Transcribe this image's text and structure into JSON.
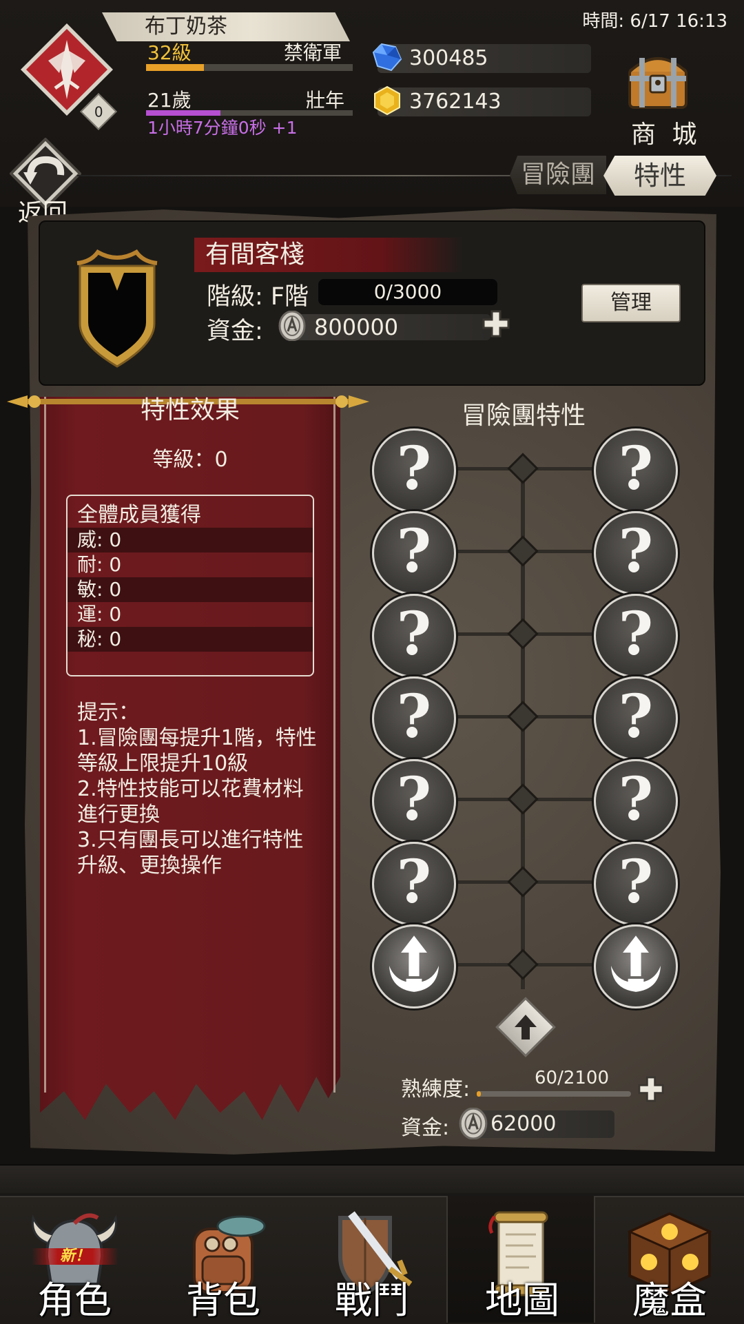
{
  "header": {
    "clock": "時間: 6/17 16:13",
    "player_name": "布丁奶茶",
    "level": "32級",
    "level_progress": 0.28,
    "rank": "禁衛軍",
    "age": "21歲",
    "life_stage": "壯年",
    "age_progress": 0.36,
    "age_timer": "1小時7分鐘0秒 +1",
    "emblem_badge": "0",
    "gems": "300485",
    "gold": "3762143",
    "shop_label": "商 城"
  },
  "nav": {
    "back_label": "返回",
    "tab_guild": "冒險團",
    "tab_trait": "特性"
  },
  "guild": {
    "name": "有間客棧",
    "grade_label": "階級: F階",
    "grade_progress": "0/3000",
    "fund_label": "資金:",
    "fund_value": "800000",
    "manage_label": "管理"
  },
  "effects": {
    "title": "特性效果",
    "level": "等級：0",
    "gain_header": "全體成員獲得",
    "stats": [
      {
        "text": "威: 0"
      },
      {
        "text": "耐: 0"
      },
      {
        "text": "敏: 0"
      },
      {
        "text": "運: 0"
      },
      {
        "text": "秘: 0"
      }
    ],
    "tips": "提示：\n1.冒險團每提升1階，特性等級上限提升10級\n2.特性技能可以花費材料進行更換\n3.只有團長可以進行特性升級、更換操作"
  },
  "tree": {
    "title": "冒險團特性",
    "locked_symbol": "?",
    "proficiency_label": "熟練度:",
    "proficiency": "60/2100",
    "proficiency_fraction": 0.0286,
    "fund_label": "資金:",
    "fund_value": "62000"
  },
  "bottom_nav": {
    "items": [
      {
        "label": "角色",
        "icon": "helmet-icon"
      },
      {
        "label": "背包",
        "icon": "backpack-icon"
      },
      {
        "label": "戰鬥",
        "icon": "sword-shield-icon"
      },
      {
        "label": "地圖",
        "icon": "scroll-map-icon"
      },
      {
        "label": "魔盒",
        "icon": "magic-box-icon"
      }
    ],
    "active_index": 3,
    "new_badge": "新！"
  },
  "colors": {
    "banner_red": "#6e1a1e",
    "level_orange": "#e8a028",
    "age_purple": "#b64fd0",
    "level_text_gold": "#f2c23a"
  }
}
